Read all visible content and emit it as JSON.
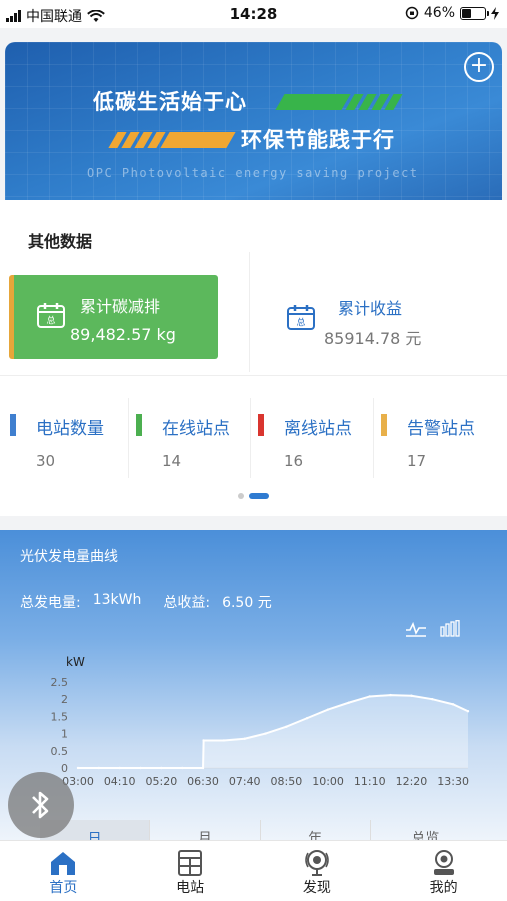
{
  "status_bar": {
    "carrier": "中国联通",
    "time": "14:28",
    "battery": "46%",
    "battery_level": 0.46
  },
  "banner": {
    "line1": "低碳生活始于心",
    "line2": "环保节能践于行",
    "subtitle": "OPC Photovoltaic energy saving project",
    "add_icon": "plus-circle-icon"
  },
  "other_data": {
    "title": "其他数据",
    "cards": [
      {
        "label": "累计碳减排",
        "value": "89,482.57 kg",
        "icon": "calendar-total-icon"
      },
      {
        "label": "累计收益",
        "value": "85914.78 元",
        "icon": "calendar-total-icon"
      }
    ],
    "icon_text": "总"
  },
  "stations": {
    "items": [
      {
        "label": "电站数量",
        "value": "30",
        "color": "#3f7fcf"
      },
      {
        "label": "在线站点",
        "value": "14",
        "color": "#4caf50"
      },
      {
        "label": "离线站点",
        "value": "16",
        "color": "#d9352f"
      },
      {
        "label": "告警站点",
        "value": "17",
        "color": "#e8b04a"
      }
    ],
    "page_count": 2,
    "active_page": 2
  },
  "pv": {
    "title": "光伏发电量曲线",
    "total_power_label": "总发电量:",
    "total_power_value": "13kWh",
    "total_income_label": "总收益:",
    "total_income_value": "6.50 元",
    "tabs": [
      "日",
      "月",
      "年",
      "总览"
    ],
    "active_tab": 0
  },
  "chart_data": {
    "type": "area",
    "ylabel": "kW",
    "ylim": [
      0,
      2.5
    ],
    "yticks": [
      "0",
      "0.5",
      "1",
      "1.5",
      "2",
      "2.5"
    ],
    "xticks": [
      "03:00",
      "04:10",
      "05:20",
      "06:30",
      "07:40",
      "08:50",
      "10:00",
      "11:10",
      "12:20",
      "13:30"
    ],
    "x": [
      "03:00",
      "03:35",
      "04:10",
      "04:45",
      "05:20",
      "05:55",
      "06:30",
      "06:31",
      "07:05",
      "07:40",
      "08:15",
      "08:50",
      "09:25",
      "10:00",
      "10:35",
      "11:10",
      "11:45",
      "12:20",
      "12:55",
      "13:30",
      "13:55"
    ],
    "values": [
      0,
      0,
      0,
      0,
      0,
      0,
      0,
      0.8,
      0.8,
      0.85,
      1.0,
      1.2,
      1.45,
      1.7,
      1.9,
      2.08,
      2.12,
      2.1,
      2.0,
      1.85,
      1.65
    ],
    "grid": false
  },
  "bottom_nav": {
    "items": [
      {
        "label": "首页",
        "icon": "home-icon"
      },
      {
        "label": "电站",
        "icon": "station-grid-icon"
      },
      {
        "label": "发现",
        "icon": "discover-icon"
      },
      {
        "label": "我的",
        "icon": "profile-icon"
      }
    ],
    "active": 0
  },
  "colors": {
    "accent": "#2b70c4",
    "green_card": "#5cb85c",
    "banner_stripe_green": "#38b44a",
    "banner_stripe_orange": "#f0a733"
  }
}
